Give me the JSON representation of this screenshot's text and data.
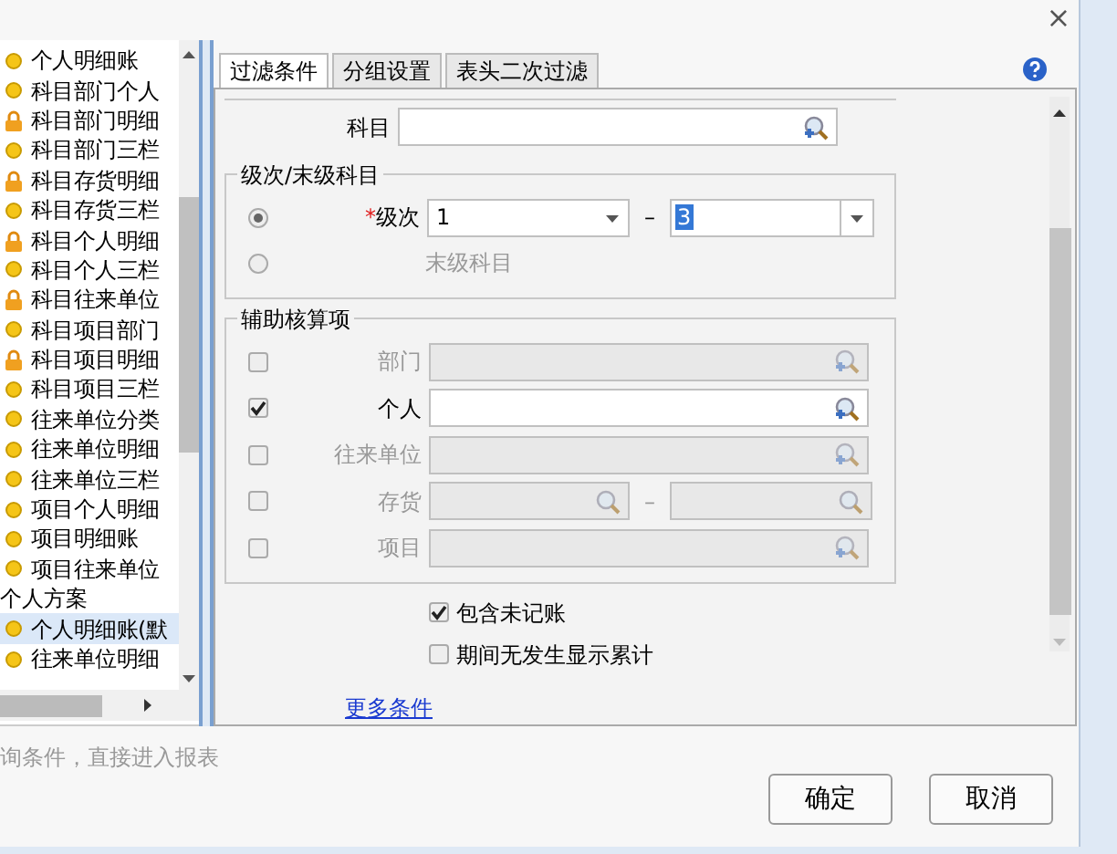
{
  "window": {
    "close": "×"
  },
  "tree": {
    "groups": [
      {
        "children": [
          {
            "label": "个人明细账",
            "kind": "circle",
            "selected": false
          },
          {
            "label": "科目部门个人",
            "kind": "circle",
            "selected": false
          },
          {
            "label": "科目部门明细",
            "kind": "lock",
            "selected": false
          },
          {
            "label": "科目部门三栏",
            "kind": "circle",
            "selected": false
          },
          {
            "label": "科目存货明细",
            "kind": "lock",
            "selected": false
          },
          {
            "label": "科目存货三栏",
            "kind": "circle",
            "selected": false
          },
          {
            "label": "科目个人明细",
            "kind": "lock",
            "selected": false
          },
          {
            "label": "科目个人三栏",
            "kind": "circle",
            "selected": false
          },
          {
            "label": "科目往来单位",
            "kind": "lock",
            "selected": false
          },
          {
            "label": "科目项目部门",
            "kind": "circle",
            "selected": false
          },
          {
            "label": "科目项目明细",
            "kind": "lock",
            "selected": false
          },
          {
            "label": "科目项目三栏",
            "kind": "circle",
            "selected": false
          },
          {
            "label": "往来单位分类",
            "kind": "circle",
            "selected": false
          },
          {
            "label": "往来单位明细",
            "kind": "circle",
            "selected": false
          },
          {
            "label": "往来单位三栏",
            "kind": "circle",
            "selected": false
          },
          {
            "label": "项目个人明细",
            "kind": "circle",
            "selected": false
          },
          {
            "label": "项目明细账",
            "kind": "circle",
            "selected": false
          },
          {
            "label": "项目往来单位",
            "kind": "circle",
            "selected": false
          }
        ]
      },
      {
        "label": "个人方案",
        "children": [
          {
            "label": "个人明细账(默",
            "kind": "circle",
            "selected": true
          },
          {
            "label": "往来单位明细",
            "kind": "circle",
            "selected": false
          }
        ]
      }
    ]
  },
  "tabs": [
    {
      "label": "过滤条件",
      "selected": true
    },
    {
      "label": "分组设置",
      "selected": false
    },
    {
      "label": "表头二次过滤",
      "selected": false
    }
  ],
  "filter": {
    "subject": {
      "label": "科目"
    },
    "level_group": {
      "title": "级次/末级科目",
      "options": [
        {
          "kind": "range",
          "required_mark": "*",
          "label": "级次",
          "selected": true,
          "from": "1",
          "separator": "–",
          "to": "3"
        },
        {
          "kind": "plain",
          "label": "末级科目",
          "selected": false
        }
      ]
    },
    "aux_group": {
      "title": "辅助核算项",
      "rows": [
        {
          "kind": "single",
          "label": "部门",
          "checked": false
        },
        {
          "kind": "single",
          "label": "个人",
          "checked": true
        },
        {
          "kind": "single",
          "label": "往来单位",
          "checked": false
        },
        {
          "kind": "range",
          "label": "存货",
          "separator": "–",
          "checked": false
        },
        {
          "kind": "single",
          "label": "项目",
          "checked": false
        }
      ]
    },
    "options": [
      {
        "label": "包含未记账",
        "checked": true
      },
      {
        "label": "期间无发生显示累计",
        "checked": false
      }
    ],
    "more_link": "更多条件"
  },
  "hint": "询条件，直接进入报表",
  "buttons": [
    "确定",
    "取消"
  ]
}
